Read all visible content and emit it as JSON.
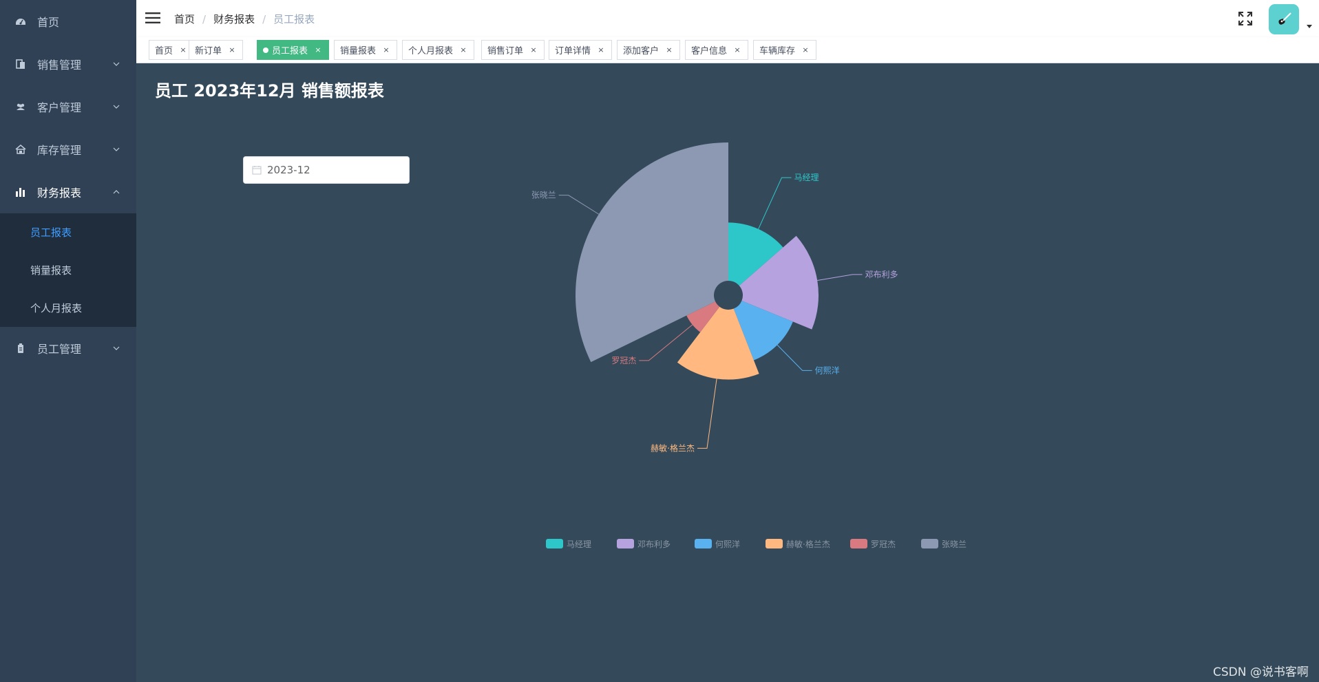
{
  "sidebar": {
    "items": [
      {
        "label": "首页"
      },
      {
        "label": "销售管理"
      },
      {
        "label": "客户管理"
      },
      {
        "label": "库存管理"
      },
      {
        "label": "财务报表"
      },
      {
        "label": "员工管理"
      }
    ],
    "finance_sub": [
      {
        "label": "员工报表"
      },
      {
        "label": "销量报表"
      },
      {
        "label": "个人月报表"
      }
    ]
  },
  "breadcrumb": [
    "首页",
    "财务报表",
    "员工报表"
  ],
  "tags": [
    {
      "label": "首页"
    },
    {
      "label": "新订单"
    },
    {
      "label": "员工报表"
    },
    {
      "label": "销量报表"
    },
    {
      "label": "个人月报表"
    },
    {
      "label": "销售订单"
    },
    {
      "label": "订单详情"
    },
    {
      "label": "添加客户"
    },
    {
      "label": "客户信息"
    },
    {
      "label": "车辆库存"
    }
  ],
  "tag_close": "×",
  "page_title": "员工 2023年12月 销售额报表",
  "date_picker": {
    "value": "2023-12"
  },
  "watermark": "CSDN @说书客啊",
  "colors": {
    "sidebar_bg": "#304156",
    "submenu_bg": "#1f2d3d",
    "active_link": "#409eff",
    "active_tag": "#42b983",
    "main_bg": "#344a5a"
  },
  "chart_data": {
    "type": "pie",
    "subtype": "rose",
    "series": [
      {
        "name": "马经理",
        "value": 40,
        "color": "#2ec7c9"
      },
      {
        "name": "邓布利多",
        "value": 52,
        "color": "#b6a2de"
      },
      {
        "name": "何熙洋",
        "value": 38,
        "color": "#5ab1ef"
      },
      {
        "name": "赫敏·格兰杰",
        "value": 48,
        "color": "#ffb980"
      },
      {
        "name": "罗冠杰",
        "value": 22,
        "color": "#d87a80"
      },
      {
        "name": "张晓兰",
        "value": 95,
        "color": "#8d98b3"
      }
    ],
    "legend_position": "bottom-center"
  }
}
